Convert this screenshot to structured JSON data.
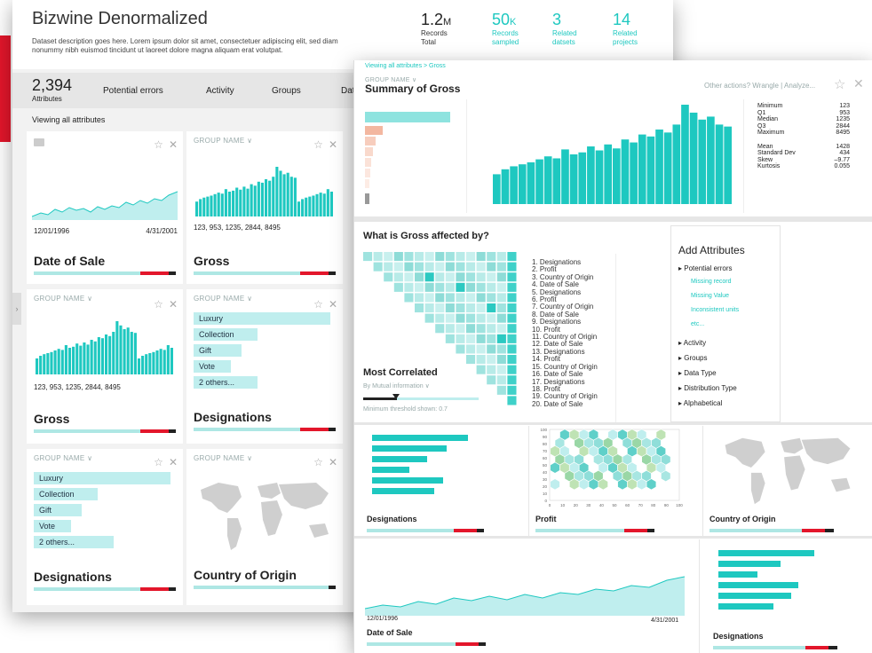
{
  "back": {
    "title": "Bizwine Denormalized",
    "description": "Dataset description goes here. Lorem ipsum dolor sit amet, consectetuer adipiscing elit, sed diam nonummy nibh euismod tincidunt ut laoreet dolore magna aliquam erat volutpat.",
    "stats": [
      {
        "value": "1.2",
        "unit": "M",
        "label": "Records Total"
      },
      {
        "value": "50",
        "unit": "K",
        "label": "Records sampled"
      },
      {
        "value": "3",
        "unit": "",
        "label": "Related datsets"
      },
      {
        "value": "14",
        "unit": "",
        "label": "Related projects"
      }
    ],
    "attr_count": "2,394",
    "attr_label": "Attributes",
    "tabs": [
      "Potential errors",
      "Activity",
      "Groups",
      "Dat"
    ],
    "viewing": "Viewing all attributes",
    "cards": [
      {
        "group": "",
        "title": "Date of Sale",
        "from": "12/01/1996",
        "to": "4/31/2001"
      },
      {
        "group": "GROUP NAME",
        "title": "Gross",
        "stats": "123, 953, 1235, 2844, 8495"
      },
      {
        "group": "GROUP NAME",
        "title": "Gross",
        "stats": "123, 953, 1235, 2844, 8495"
      },
      {
        "group": "GROUP NAME",
        "title": "Designations",
        "tags": [
          "Luxury",
          "Collection",
          "Gift",
          "Vote",
          "2 others..."
        ]
      },
      {
        "group": "GROUP NAME",
        "title": "Designations",
        "tags": [
          "Luxury",
          "Collection",
          "Gift",
          "Vote",
          "2 others..."
        ]
      },
      {
        "group": "GROUP NAME",
        "title": "Country of Origin"
      }
    ]
  },
  "front": {
    "breadcrumb": "Viewing all attributes > Gross",
    "group": "GROUP NAME",
    "title": "Summary of Gross",
    "other_actions": "Other actions? Wrangle | Analyze...",
    "stats": [
      {
        "k": "Minimum",
        "v": "123"
      },
      {
        "k": "Q1",
        "v": "953"
      },
      {
        "k": "Median",
        "v": "1235"
      },
      {
        "k": "Q3",
        "v": "2844"
      },
      {
        "k": "Maximum",
        "v": "8495"
      },
      {
        "k": "Mean",
        "v": "1428"
      },
      {
        "k": "Standard Dev",
        "v": "434"
      },
      {
        "k": "Skew",
        "v": "–9.77"
      },
      {
        "k": "Kurtosis",
        "v": "0.055"
      }
    ],
    "affected_q": "What is Gross affected by?",
    "most_correlated": "Most Correlated",
    "by_mutual": "By Mutual information",
    "threshold": "Minimum threshold shown: 0.7",
    "correlated_list": [
      "1. Designations",
      "2. Profit",
      "3. Country of Origin",
      "4. Date of Sale",
      "5. Designations",
      "6. Profit",
      "7. Country of Origin",
      "8. Date of Sale",
      "9. Designations",
      "10. Profit",
      "11. Country of Origin",
      "12. Date of Sale",
      "13. Designations",
      "14. Profit",
      "15. Country of Origin",
      "16. Date of Sale",
      "17. Designations",
      "18. Profit",
      "19. Country of Origin",
      "20. Date of Sale"
    ],
    "add_attributes": {
      "title": "Add Attributes",
      "items": [
        "Potential errors",
        "Activity",
        "Groups",
        "Data Type",
        "Distribution Type",
        "Alphabetical"
      ],
      "sub": [
        "Missing record",
        "Missing Value",
        "Inconsistent units",
        "etc..."
      ]
    },
    "mini": {
      "designations": "Designations",
      "profit": "Profit",
      "country": "Country of Origin",
      "date": "Date of Sale",
      "date_from": "12/01/1996",
      "date_to": "4/31/2001",
      "designations2": "Designations",
      "profit_y": [
        "100",
        "90",
        "80",
        "70",
        "60",
        "50",
        "40",
        "30",
        "20",
        "10",
        "0"
      ],
      "profit_x": [
        "0",
        "10",
        "20",
        "30",
        "40",
        "50",
        "60",
        "70",
        "80",
        "90",
        "100"
      ]
    },
    "colors": {
      "accent": "#1ec8c0",
      "error": "#e3162b",
      "brand": "#e3162b"
    },
    "histogram_values": [
      30,
      35,
      38,
      40,
      42,
      45,
      48,
      46,
      55,
      50,
      52,
      58,
      54,
      60,
      56,
      65,
      62,
      70,
      68,
      75,
      72,
      80,
      100,
      92,
      85,
      88,
      80,
      78
    ]
  }
}
